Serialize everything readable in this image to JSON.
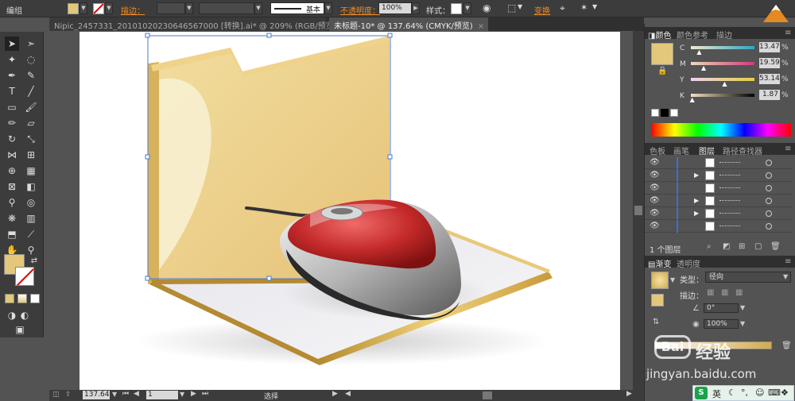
{
  "topbar": {
    "selection_label": "编组",
    "stroke_label": "描边：",
    "brush_label": "基本",
    "opacity_label": "不透明度：",
    "opacity_value": "100%",
    "style_label": "样式：",
    "transform_label": "变换"
  },
  "tabs": [
    {
      "label": "Nipic_2457331_20101020230646567000 [转换].ai* @ 209% (RGB/预览)",
      "active": false
    },
    {
      "label": "未标题-10* @ 137.64% (CMYK/预览)",
      "active": true
    }
  ],
  "color_panel": {
    "tabs": [
      "颜色",
      "颜色参考",
      "描边"
    ],
    "channels": [
      {
        "name": "C",
        "value": "13.47",
        "pos": 0.13,
        "gradient": "linear-gradient(to right,#f4e7c8,#2aa6c6)"
      },
      {
        "name": "M",
        "value": "19.59",
        "pos": 0.2,
        "gradient": "linear-gradient(to right,#e8d9b8,#d23a7e)"
      },
      {
        "name": "Y",
        "value": "53.14",
        "pos": 0.53,
        "gradient": "linear-gradient(to right,#f0d0f0,#e0d040)"
      },
      {
        "name": "K",
        "value": "1.87",
        "pos": 0.02,
        "gradient": "linear-gradient(to right,#f2e3bf,#000)"
      }
    ],
    "fill_color": "#e3c77a"
  },
  "layers_panel": {
    "tabs": [
      "色板",
      "画笔",
      "图层",
      "路径查找器"
    ],
    "rows": [
      {
        "expandable": false
      },
      {
        "expandable": true
      },
      {
        "expandable": false
      },
      {
        "expandable": true
      },
      {
        "expandable": true
      },
      {
        "expandable": false
      }
    ],
    "footer_label": "1 个图层"
  },
  "gradient_panel": {
    "tabs": [
      "渐变",
      "透明度"
    ],
    "type_label": "类型：",
    "type_value": "径向",
    "stroke_label": "描边：",
    "angle_value": "0°",
    "scale_value": "100%"
  },
  "status": {
    "zoom": "137.64",
    "page": "1",
    "tool_label": "选择"
  },
  "watermark": {
    "brand_text": "经验",
    "url_text": "jingyan.baidu.com",
    "ime_label": "英"
  },
  "colors": {
    "ui_dark": "#3c3c3c",
    "ui_mid": "#535353",
    "accent_orange": "#f08a24",
    "folder_gold": "#e3c77a",
    "mouse_red": "#c42a2a"
  }
}
